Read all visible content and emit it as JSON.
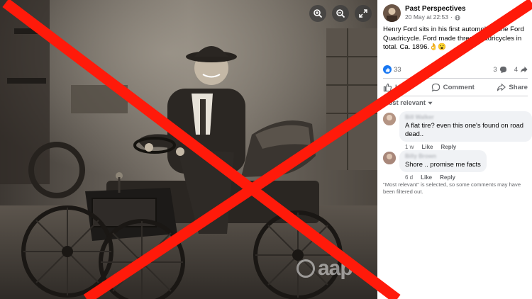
{
  "viewer": {
    "zoom_in_icon": "zoom-in-icon",
    "zoom_out_icon": "zoom-out-icon",
    "fullscreen_icon": "expand-icon",
    "watermark": "aap"
  },
  "post": {
    "page_name": "Past Perspectives",
    "date": "20 May at 22:53",
    "visibility_icon": "globe-icon",
    "caption": "Henry Ford sits in his first automobile, the Ford Quadricycle. Ford made three Quadricycles in total. Ca. 1896.👌😮",
    "reactions_count": "33",
    "comments_count": "3",
    "shares_count": "4"
  },
  "actions": {
    "like": "Like",
    "comment": "Comment",
    "share": "Share"
  },
  "comments": {
    "sort_label": "Most relevant",
    "items": [
      {
        "name": "Bill Walker",
        "text": "A flat tire? even this one's found on road dead..",
        "time": "1 w",
        "like": "Like",
        "reply": "Reply"
      },
      {
        "name": "Billy Brown",
        "text": "Shore .. promise me facts",
        "time": "6 d",
        "like": "Like",
        "reply": "Reply"
      }
    ],
    "filter_note": "\"Most relevant\" is selected, so some comments may have been filtered out."
  },
  "colors": {
    "x_red": "#ff1a0a",
    "fb_blue": "#1877f2",
    "meta_gray": "#65676b",
    "bubble_gray": "#f0f2f5"
  }
}
